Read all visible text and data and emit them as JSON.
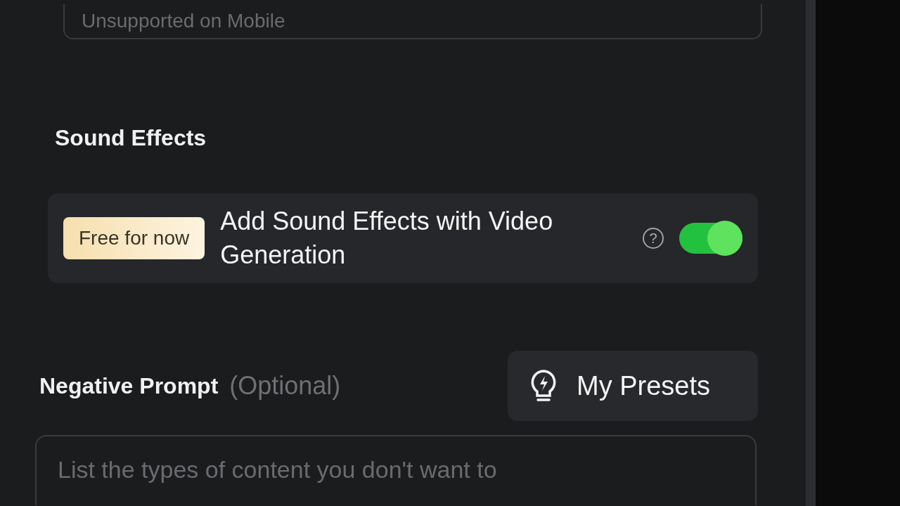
{
  "top_field": {
    "placeholder": "Unsupported on Mobile"
  },
  "sound_effects": {
    "title": "Sound Effects",
    "badge": "Free for now",
    "label": "Add Sound Effects with Video Generation",
    "help": "?",
    "on": true
  },
  "negative_prompt": {
    "title": "Negative Prompt",
    "hint": "(Optional)",
    "presets_button": "My Presets",
    "placeholder": "List the types of content you don't want to"
  }
}
